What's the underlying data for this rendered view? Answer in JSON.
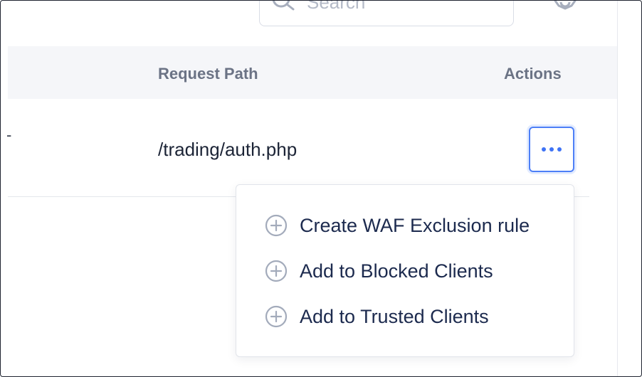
{
  "toolbar": {
    "search_placeholder": "Search",
    "search_icon": "search-icon",
    "settings_icon": "gear-icon"
  },
  "table": {
    "columns": [
      "Request Path",
      "Actions"
    ],
    "rows": [
      {
        "leading_value": "-",
        "request_path": "/trading/auth.php",
        "action_icon": "more-horizontal-icon"
      }
    ]
  },
  "actions_menu": {
    "items": [
      {
        "label": "Create WAF Exclusion rule",
        "icon": "plus-circle-icon"
      },
      {
        "label": "Add to Blocked Clients",
        "icon": "plus-circle-icon"
      },
      {
        "label": "Add to Trusted Clients",
        "icon": "plus-circle-icon"
      }
    ]
  },
  "colors": {
    "accent": "#3f73f5",
    "header_bg": "#f5f6f9",
    "menu_text": "#1c2a4e",
    "header_text": "#6b7385"
  }
}
